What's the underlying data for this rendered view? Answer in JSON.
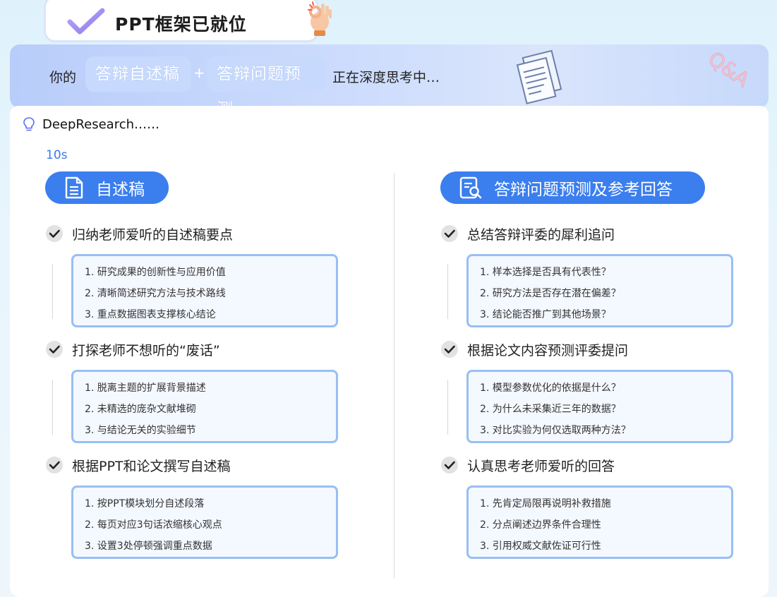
{
  "header": {
    "title": "PPT框架已就位"
  },
  "banner": {
    "prefix": "你的",
    "chip_a": "答辩自述稿",
    "plus": "+",
    "chip_b": "答辩问题预测",
    "suffix": "正在深度思考中…",
    "badge": "Q&A"
  },
  "status": {
    "label": "DeepResearch……",
    "elapsed": "10s"
  },
  "left": {
    "heading": "自述稿",
    "sections": [
      {
        "title": "归纳老师爱听的自述稿要点",
        "items": [
          "1. 研究成果的创新性与应用价值",
          "2. 清晰简述研究方法与技术路线",
          "3. 重点数据图表支撑核心结论"
        ]
      },
      {
        "title": "打探老师不想听的“废话”",
        "items": [
          "1. 脱离主题的扩展背景描述",
          "2. 未精选的庞杂文献堆砌",
          "3. 与结论无关的实验细节"
        ]
      },
      {
        "title": "根据PPT和论文撰写自述稿",
        "items": [
          "1. 按PPT模块划分自述段落",
          "2. 每页对应3句话浓缩核心观点",
          "3. 设置3处停顿强调重点数据"
        ]
      }
    ]
  },
  "right": {
    "heading": "答辩问题预测及参考回答",
    "sections": [
      {
        "title": "总结答辩评委的犀利追问",
        "items": [
          "1. 样本选择是否具有代表性？",
          "2. 研究方法是否存在潜在偏差？",
          "3. 结论能否推广到其他场景？"
        ]
      },
      {
        "title": "根据论文内容预测评委提问",
        "items": [
          "1. 模型参数优化的依据是什么？",
          "2. 为什么未采集近三年的数据？",
          "3. 对比实验为何仅选取两种方法？"
        ]
      },
      {
        "title": "认真思考老师爱听的回答",
        "items": [
          "1. 先肯定局限再说明补救措施",
          "2. 分点阐述边界条件合理性",
          "3. 引用权威文献佐证可行性"
        ]
      }
    ]
  },
  "colors": {
    "accent": "#3b7eee",
    "box_border": "#98bff3",
    "time": "#3a79e8"
  },
  "icons": [
    "checkmark-icon",
    "ok-hand-icon",
    "documents-icon",
    "lightbulb-icon",
    "document-icon",
    "search-document-icon",
    "check-circle-icon"
  ]
}
